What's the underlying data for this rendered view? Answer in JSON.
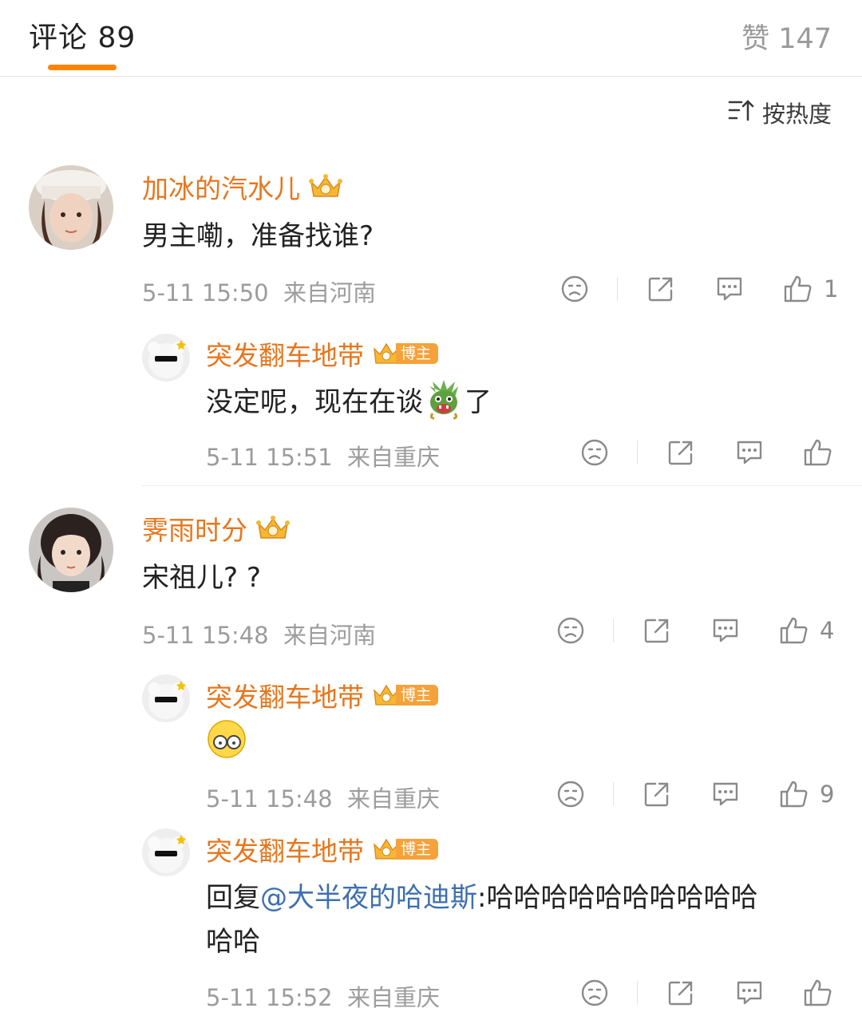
{
  "header": {
    "tab_comments": "评论 89",
    "tab_likes": "赞 147",
    "sort_label": "按热度",
    "accent_color": "#ff8200"
  },
  "comments": [
    {
      "user": "加冰的汽水儿",
      "text": "男主嘞，准备找谁?",
      "time": "5-11 15:50",
      "location": "来自河南",
      "likes": "1",
      "reply": {
        "user": "突发翻车地带",
        "badge": "博主",
        "text": "没定呢，现在在谈",
        "text_after": "了",
        "emoji": "dragon-emoji",
        "time": "5-11 15:51",
        "location": "来自重庆"
      }
    },
    {
      "user": "霁雨时分",
      "text": "宋祖儿? ?",
      "time": "5-11 15:48",
      "location": "来自河南",
      "likes": "4",
      "replies": [
        {
          "user": "突发翻车地带",
          "badge": "博主",
          "emoji": "glasses-face-emoji",
          "time": "5-11 15:48",
          "location": "来自重庆",
          "likes": "9"
        },
        {
          "user": "突发翻车地带",
          "badge": "博主",
          "text_prefix": "回复",
          "mention": "@大半夜的哈迪斯",
          "text_line1": ":哈哈哈哈哈哈哈哈哈哈",
          "text_line2": "哈哈",
          "time": "5-11 15:52",
          "location": "来自重庆"
        }
      ]
    }
  ]
}
